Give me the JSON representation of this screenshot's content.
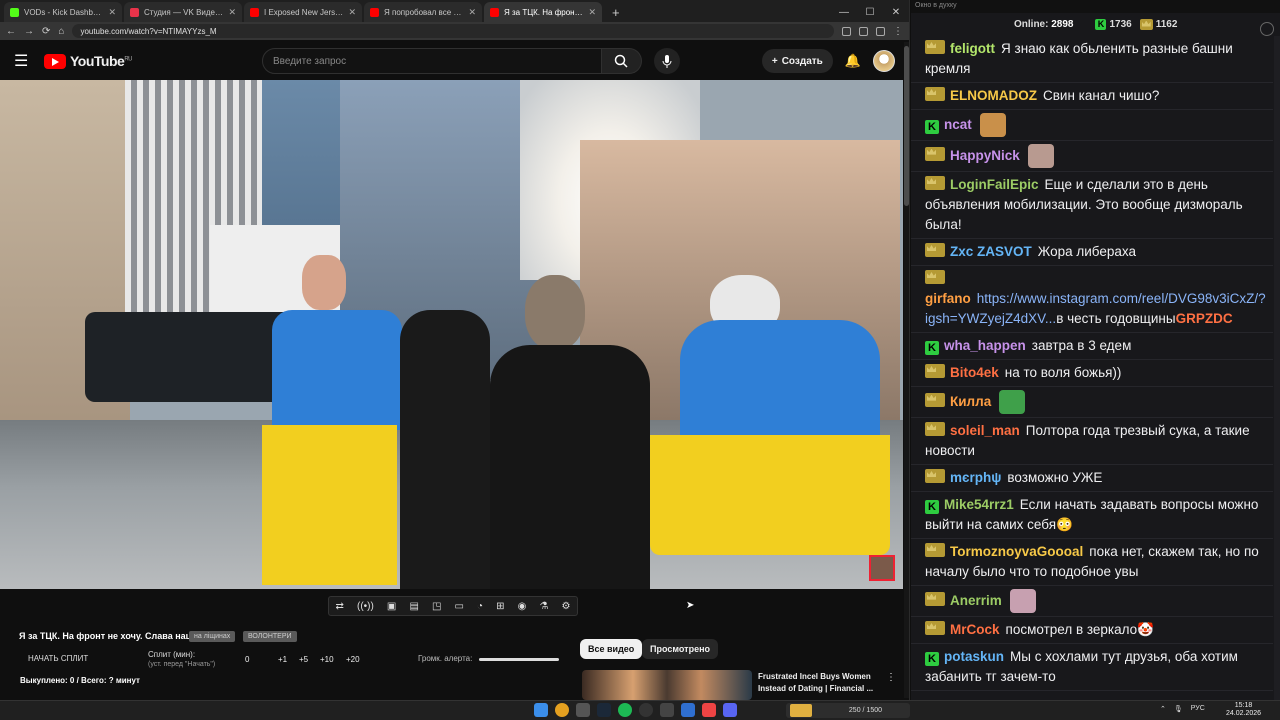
{
  "browser": {
    "tabs": [
      {
        "title": "VODs - Kick Dashboard",
        "color": "#53fc18"
      },
      {
        "title": "Студия — VK Видео Live",
        "color": "#e8334a"
      },
      {
        "title": "I Exposed New Jersey's Jewish",
        "color": "#ff0000"
      },
      {
        "title": "Я попробовал все способы б",
        "color": "#ff0000"
      },
      {
        "title": "Я за ТЦК. На фронт не хочу. С",
        "color": "#ff0000"
      }
    ],
    "url": "youtube.com/watch?v=NTIMAYYzs_M"
  },
  "youtube": {
    "logo_text": "YouTube",
    "logo_region": "RU",
    "search_placeholder": "Введите запрос",
    "create_label": "Создать"
  },
  "video": {
    "title": "Я за ТЦК. На фронт не хочу. Слава нації",
    "tag1": "на ліщинах",
    "tag2": "ВОЛОНТЕРИ",
    "control_icons": [
      "loop-icon",
      "audio-icon",
      "screen-icon",
      "film-icon",
      "pip-icon",
      "subtitles-icon",
      "speed-icon",
      "add-icon",
      "camera-icon",
      "lab-icon",
      "settings-icon"
    ]
  },
  "split": {
    "start_label": "НАЧАТЬ СПЛИТ",
    "split_label": "Сплит (мин):",
    "split_hint": "(уст. перед \"Начать\")",
    "value": "0",
    "increments": [
      "+1",
      "+5",
      "+10",
      "+20"
    ],
    "volume_label": "Громк. алерта:",
    "volume_level": 1.0,
    "bought": "Выкуплено: 0 / Всего: ? минут"
  },
  "recommend": {
    "chip_all": "Все видео",
    "chip_watched": "Просмотрено",
    "title": "Frustrated Incel Buys Women Instead of Dating | Financial ..."
  },
  "chat": {
    "window_title": "Окно в духку",
    "online_label": "Online:",
    "online_count": "2898",
    "kick_count": "1736",
    "vk_count": "1162",
    "messages": [
      {
        "badge": "crown",
        "user": "feligott",
        "color": "#b3e66b",
        "text": "Я знаю как обьленить разные башни кремля"
      },
      {
        "badge": "crown",
        "user": "ELNOMADOZ",
        "color": "#f7c948",
        "text": "Свин канал чишо?"
      },
      {
        "badge": "kick",
        "user": "ncat",
        "color": "#c792ea",
        "text": "",
        "emote": "#c9904a"
      },
      {
        "badge": "crown",
        "user": "HappyNick",
        "color": "#c792ea",
        "text": "",
        "emote": "#b89a90"
      },
      {
        "badge": "crown",
        "user": "LoginFailEpic",
        "color": "#9ccc65",
        "text": "Еще и сделали это в день объявления мобилизации. Это вообще дизмораль была!"
      },
      {
        "badge": "crown",
        "user": "Zxc ZASVOT",
        "color": "#64b5f6",
        "text": "Жора либераха"
      },
      {
        "badge": "crown",
        "user": "girfano",
        "color": "#ff9f43",
        "text": "",
        "link": "https://www.instagram.com/reel/DVG98v3iCxZ/?igsh=YWZyejZ4dXV...",
        "tail": "в честь годовщины",
        "tail2": "GRPZDC"
      },
      {
        "badge": "kick",
        "user": "wha_happen",
        "color": "#c792ea",
        "text": "завтра в 3 едем"
      },
      {
        "badge": "crown",
        "user": "Bito4ek",
        "color": "#ff7043",
        "text": "на то воля божья))"
      },
      {
        "badge": "crown",
        "user": "Килла",
        "color": "#ff9f43",
        "text": "",
        "emote": "#3fa04a"
      },
      {
        "badge": "crown",
        "user": "soleil_man",
        "color": "#ff7043",
        "text": "Полтора года трезвый сука, а такие новости"
      },
      {
        "badge": "crown",
        "user": "mєrphψ",
        "color": "#64b5f6",
        "text": "возможно УЖЕ"
      },
      {
        "badge": "kick",
        "user": "Mike54rrz1",
        "color": "#9ccc65",
        "text": "Если начать задавать вопросы можно выйти на самих себя😳"
      },
      {
        "badge": "crown",
        "user": "TormoznoyvaGoooal",
        "color": "#f7c948",
        "text": "пока нет, скажем так, но по началу было что то подобное увы"
      },
      {
        "badge": "crown",
        "user": "Anerrim",
        "color": "#9ccc65",
        "text": "",
        "emote": "#c7a0b0"
      },
      {
        "badge": "crown",
        "user": "MrCock",
        "color": "#ff7043",
        "text": "посмотрел в зеркало🤡"
      },
      {
        "badge": "kick",
        "user": "potaskun",
        "color": "#64b5f6",
        "text": "Мы с хохлами тут друзья, оба хотим забанить тг зачем-то"
      }
    ]
  },
  "taskbar": {
    "widget_text": "250 / 1500",
    "lang": "РУС",
    "time": "15:18",
    "date": "24.02.2026"
  }
}
